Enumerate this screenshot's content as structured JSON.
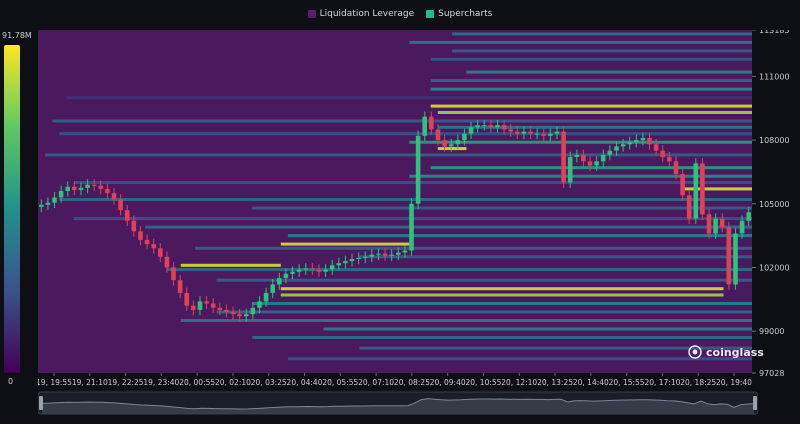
{
  "legend": {
    "items": [
      {
        "label": "Liquidation Leverage",
        "color": "#5b1d6e"
      },
      {
        "label": "Supercharts",
        "color": "#12c286"
      }
    ]
  },
  "colorbar": {
    "max_label": "91.78M",
    "min_label": "0",
    "stops": [
      "#440154",
      "#3b528b",
      "#21918c",
      "#5ec962",
      "#fde725"
    ]
  },
  "brand": {
    "name": "coinglass"
  },
  "chart_data": {
    "type": "heatmap",
    "title": "",
    "xlabel": "",
    "ylabel": "",
    "ylim": [
      97028,
      113185
    ],
    "y_tick_labels": [
      "113185",
      "111000",
      "108000",
      "105000",
      "102000",
      "99000",
      "97028"
    ],
    "y_ticks": [
      113185,
      111000,
      108000,
      105000,
      102000,
      99000,
      97028
    ],
    "x_tick_labels": [
      "19, 19:55",
      "19, 21:10",
      "19, 22:25",
      "19, 23:40",
      "20, 00:55",
      "20, 02:10",
      "20, 03:25",
      "20, 04:40",
      "20, 05:55",
      "20, 07:10",
      "20, 08:25",
      "20, 09:40",
      "20, 10:55",
      "20, 12:10",
      "20, 13:25",
      "20, 14:40",
      "20, 15:55",
      "20, 17:10",
      "20, 18:25",
      "20, 19:40"
    ],
    "heatmap_background": "#4b1a5e",
    "price_series": {
      "name": "",
      "up_color": "#2ec27e",
      "down_color": "#e0405a",
      "close": [
        104950,
        105050,
        105300,
        105600,
        105800,
        105650,
        105750,
        105900,
        105850,
        105700,
        105500,
        105200,
        104700,
        104200,
        103700,
        103300,
        103100,
        102900,
        102500,
        102000,
        101400,
        100800,
        100200,
        100000,
        100400,
        100300,
        100100,
        100000,
        99900,
        99800,
        99700,
        99800,
        100100,
        100400,
        100800,
        101200,
        101500,
        101700,
        101800,
        101900,
        101950,
        101900,
        101800,
        101900,
        102100,
        102200,
        102300,
        102400,
        102450,
        102500,
        102600,
        102650,
        102550,
        102600,
        102700,
        102800,
        105000,
        108200,
        109100,
        108500,
        108000,
        107700,
        107800,
        108000,
        108300,
        108600,
        108700,
        108700,
        108600,
        108700,
        108500,
        108400,
        108300,
        108400,
        108300,
        108300,
        108200,
        108300,
        108400,
        106000,
        107200,
        107300,
        107000,
        106800,
        107000,
        107300,
        107500,
        107700,
        107800,
        107900,
        108000,
        108100,
        107800,
        107500,
        107200,
        107000,
        106400,
        105400,
        104300,
        106900,
        104500,
        103600,
        104300,
        103900,
        101200,
        103600,
        104200,
        104600
      ]
    },
    "liquidation_levels": [
      {
        "price": 113000,
        "start": 0.58,
        "end": 1.0,
        "intensity": 0.35
      },
      {
        "price": 112600,
        "start": 0.52,
        "end": 1.0,
        "intensity": 0.4
      },
      {
        "price": 112200,
        "start": 0.58,
        "end": 1.0,
        "intensity": 0.3
      },
      {
        "price": 111800,
        "start": 0.55,
        "end": 1.0,
        "intensity": 0.25
      },
      {
        "price": 111200,
        "start": 0.6,
        "end": 1.0,
        "intensity": 0.45
      },
      {
        "price": 110800,
        "start": 0.55,
        "end": 1.0,
        "intensity": 0.35
      },
      {
        "price": 110400,
        "start": 0.55,
        "end": 1.0,
        "intensity": 0.5
      },
      {
        "price": 110000,
        "start": 0.04,
        "end": 1.0,
        "intensity": 0.15
      },
      {
        "price": 109600,
        "start": 0.55,
        "end": 1.0,
        "intensity": 0.95
      },
      {
        "price": 109300,
        "start": 0.56,
        "end": 1.0,
        "intensity": 0.85
      },
      {
        "price": 108900,
        "start": 0.02,
        "end": 1.0,
        "intensity": 0.3
      },
      {
        "price": 108600,
        "start": 0.56,
        "end": 1.0,
        "intensity": 0.4
      },
      {
        "price": 108300,
        "start": 0.03,
        "end": 1.0,
        "intensity": 0.25
      },
      {
        "price": 107900,
        "start": 0.52,
        "end": 1.0,
        "intensity": 0.55
      },
      {
        "price": 107600,
        "start": 0.56,
        "end": 0.6,
        "intensity": 0.95
      },
      {
        "price": 107300,
        "start": 0.01,
        "end": 1.0,
        "intensity": 0.3
      },
      {
        "price": 106700,
        "start": 0.55,
        "end": 1.0,
        "intensity": 0.55
      },
      {
        "price": 106300,
        "start": 0.52,
        "end": 1.0,
        "intensity": 0.5
      },
      {
        "price": 106000,
        "start": 0.05,
        "end": 1.0,
        "intensity": 0.25
      },
      {
        "price": 105700,
        "start": 0.9,
        "end": 1.0,
        "intensity": 0.95
      },
      {
        "price": 105200,
        "start": 0.03,
        "end": 1.0,
        "intensity": 0.35
      },
      {
        "price": 104800,
        "start": 0.3,
        "end": 1.0,
        "intensity": 0.3
      },
      {
        "price": 104300,
        "start": 0.05,
        "end": 1.0,
        "intensity": 0.25
      },
      {
        "price": 103900,
        "start": 0.15,
        "end": 1.0,
        "intensity": 0.35
      },
      {
        "price": 103500,
        "start": 0.35,
        "end": 1.0,
        "intensity": 0.45
      },
      {
        "price": 103100,
        "start": 0.34,
        "end": 0.52,
        "intensity": 0.95
      },
      {
        "price": 102900,
        "start": 0.22,
        "end": 1.0,
        "intensity": 0.3
      },
      {
        "price": 102500,
        "start": 0.45,
        "end": 1.0,
        "intensity": 0.3
      },
      {
        "price": 102100,
        "start": 0.2,
        "end": 0.34,
        "intensity": 0.95
      },
      {
        "price": 101900,
        "start": 0.18,
        "end": 1.0,
        "intensity": 0.35
      },
      {
        "price": 101400,
        "start": 0.25,
        "end": 1.0,
        "intensity": 0.3
      },
      {
        "price": 101000,
        "start": 0.34,
        "end": 0.96,
        "intensity": 0.95
      },
      {
        "price": 100700,
        "start": 0.34,
        "end": 0.96,
        "intensity": 0.85
      },
      {
        "price": 100300,
        "start": 0.3,
        "end": 1.0,
        "intensity": 0.45
      },
      {
        "price": 99900,
        "start": 0.25,
        "end": 1.0,
        "intensity": 0.35
      },
      {
        "price": 99500,
        "start": 0.2,
        "end": 1.0,
        "intensity": 0.4
      },
      {
        "price": 99100,
        "start": 0.4,
        "end": 1.0,
        "intensity": 0.45
      },
      {
        "price": 98700,
        "start": 0.3,
        "end": 1.0,
        "intensity": 0.35
      },
      {
        "price": 98200,
        "start": 0.45,
        "end": 1.0,
        "intensity": 0.3
      },
      {
        "price": 97700,
        "start": 0.35,
        "end": 1.0,
        "intensity": 0.25
      }
    ]
  }
}
